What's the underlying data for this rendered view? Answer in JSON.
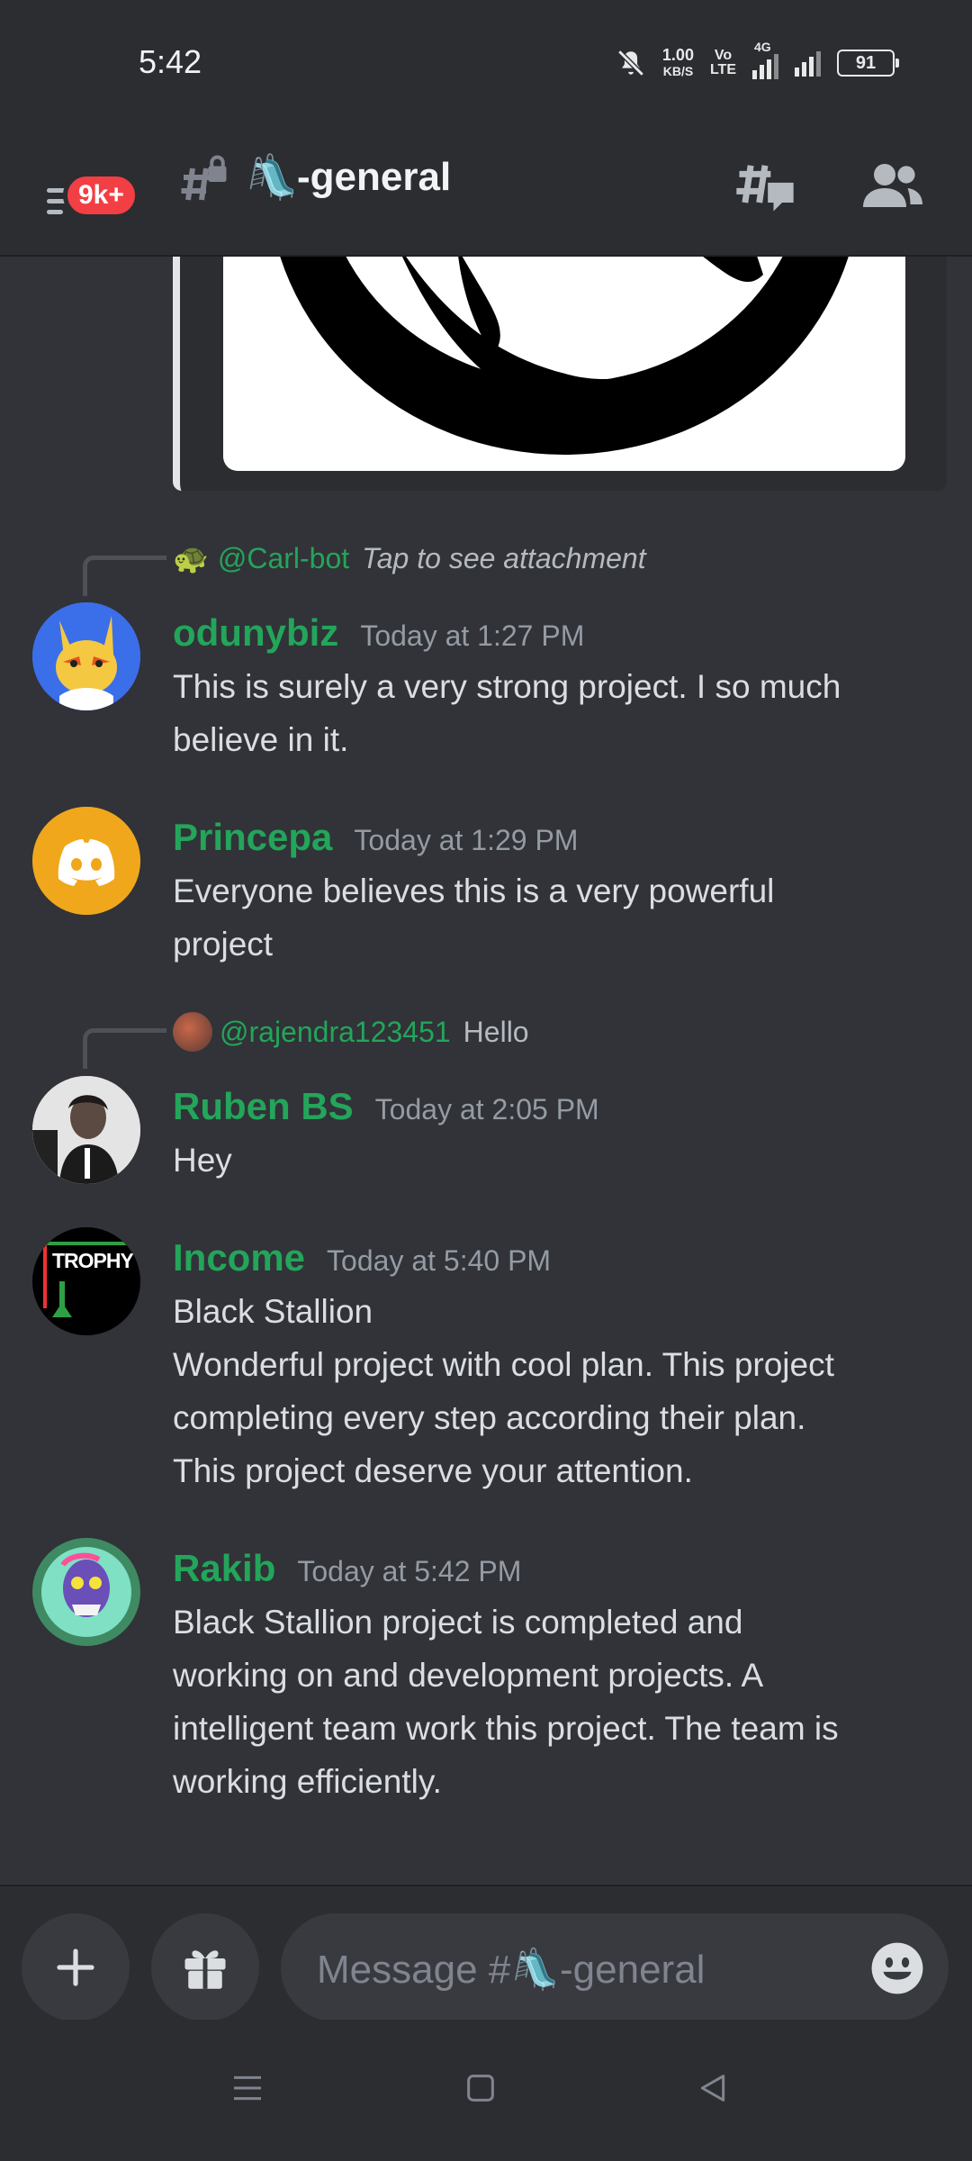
{
  "status": {
    "time": "5:42",
    "speed_value": "1.00",
    "speed_unit": "KB/S",
    "volte_top": "Vo",
    "volte_bottom": "LTE",
    "network": "4G",
    "battery": "91"
  },
  "header": {
    "badge": "9k+",
    "channel_emoji": "🛝",
    "channel_name": "-general"
  },
  "messages": [
    {
      "reply": {
        "author": "@Carl-bot",
        "text": "Tap to see attachment",
        "emoji": "🐢"
      },
      "author": "odunybiz",
      "timestamp": "Today at 1:27 PM",
      "lines": [
        "This is surely a very strong project. I so much",
        "believe in it."
      ]
    },
    {
      "author": "Princepa",
      "timestamp": "Today at 1:29 PM",
      "lines": [
        "Everyone believes this is a very powerful",
        "project"
      ]
    },
    {
      "reply": {
        "author": "@rajendra123451",
        "text": "Hello"
      },
      "author": "Ruben BS",
      "timestamp": "Today at 2:05 PM",
      "lines": [
        "Hey"
      ]
    },
    {
      "author": "Income",
      "timestamp": "Today at 5:40 PM",
      "avatar_text": "TROPHY",
      "lines": [
        "Black Stallion",
        "Wonderful project with cool plan. This project",
        "completing every step according their plan.",
        "This project deserve your attention."
      ]
    },
    {
      "author": "Rakib",
      "timestamp": "Today at 5:42 PM",
      "lines": [
        "Black Stallion project is completed and",
        "working on and development projects. A",
        "intelligent team work this project. The team is",
        "working efficiently."
      ]
    }
  ],
  "composer": {
    "placeholder": "Message #🛝-general"
  },
  "colors": {
    "background": "#313338",
    "header": "#2b2d31",
    "username": "#23a55a",
    "badge": "#f23f43",
    "blurple": "#5865f2",
    "discord_orange": "#f0a71b"
  }
}
